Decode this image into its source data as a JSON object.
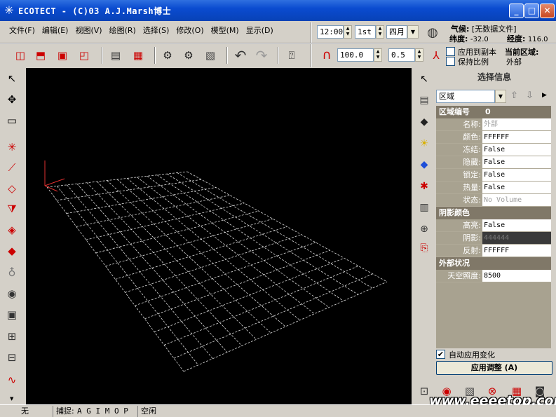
{
  "window": {
    "title": "ECOTECT - (C)03 A.J.Marsh博士",
    "logo_glyph": "✳",
    "minimize_glyph": "_",
    "maximize_glyph": "□",
    "close_glyph": "✕"
  },
  "menu": [
    {
      "label": "文件(F)"
    },
    {
      "label": "编辑(E)"
    },
    {
      "label": "视图(V)"
    },
    {
      "label": "绘图(R)"
    },
    {
      "label": "选择(S)"
    },
    {
      "label": "修改(O)"
    },
    {
      "label": "模型(M)"
    },
    {
      "label": "显示(D)"
    }
  ],
  "time_controls": {
    "time": "12:00",
    "day": "1st",
    "month": "四月"
  },
  "weather": {
    "climate_label": "气候:",
    "climate_value": "[无数据文件]",
    "latitude_label": "纬度:",
    "latitude_value": "-32.0",
    "longitude_label": "经度:",
    "longitude_value": "116.0"
  },
  "toolbar2": {
    "value1": "100.0",
    "value2": "0.5",
    "apply_to_copy_label": "应用到副本",
    "keep_ratio_label": "保持比例",
    "current_zone_label": "当前区域:",
    "current_zone_value": "外部"
  },
  "panel": {
    "title": "选择信息",
    "zone_select": "区域",
    "sections": [
      {
        "head": "区域编号",
        "head_value": "0",
        "rows": [
          {
            "label": "名称:",
            "value": "外部",
            "style": "dim"
          },
          {
            "label": "颜色:",
            "value": "FFFFFF",
            "style": ""
          },
          {
            "label": "冻结:",
            "value": "False",
            "style": ""
          },
          {
            "label": "隐藏:",
            "value": "False",
            "style": ""
          },
          {
            "label": "锁定:",
            "value": "False",
            "style": ""
          },
          {
            "label": "热量:",
            "value": "False",
            "style": ""
          },
          {
            "label": "状态:",
            "value": "No Volume",
            "style": "dim"
          }
        ]
      },
      {
        "head": "阴影颜色",
        "head_value": "",
        "rows": [
          {
            "label": "高亮:",
            "value": "False",
            "style": ""
          },
          {
            "label": "阴影:",
            "value": "444444",
            "style": "dark"
          },
          {
            "label": "反射:",
            "value": "FFFFFF",
            "style": ""
          }
        ]
      },
      {
        "head": "外部状况",
        "head_value": "",
        "rows": [
          {
            "label": "天空照度:",
            "value": "8500",
            "style": ""
          }
        ]
      }
    ],
    "auto_apply_label": "自动应用变化",
    "apply_button": "应用调整 (A)"
  },
  "status": {
    "cell1": "无",
    "snap_label": "捕捉:",
    "snap_modes": "A  G I  M O P",
    "state": "空闲"
  },
  "watermark": "www.eeeetop.com",
  "colors": {
    "titlebar": "#0a4bd0",
    "viewport_bg": "#000000",
    "grid_line": "#ffffff",
    "panel_section": "#807868",
    "panel_label": "#a8a290"
  }
}
